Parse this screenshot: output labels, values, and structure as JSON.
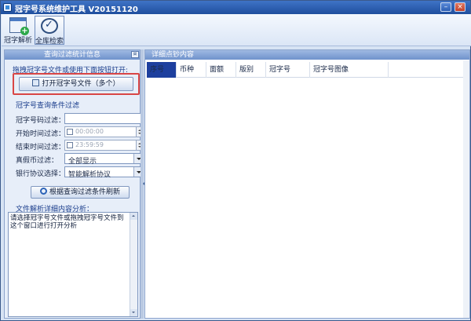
{
  "window": {
    "title": "冠字号系统维护工具 V20151120",
    "min_glyph": "–",
    "close_glyph": "×",
    "app_icon": "app-window-icon"
  },
  "toolbar": {
    "items": [
      {
        "label": "冠字解析",
        "icon": "window-add-icon"
      },
      {
        "label": "全库检索",
        "icon": "check-circle-icon"
      }
    ]
  },
  "left_panel": {
    "header": "查询过滤统计信息",
    "pin_glyph": "¤",
    "drag_hint": "拖拽冠字号文件或使用下面按钮打开:",
    "open_button": "打开冠字号文件（多个）",
    "filter_title": "冠字号查询条件过滤",
    "filters": {
      "code_label": "冠字号码过滤：",
      "code_value": "",
      "start_label": "开始时间过滤：",
      "start_value": "00:00:00",
      "end_label": "结束时间过滤：",
      "end_value": "23:59:59",
      "genuine_label": "真假币过滤：",
      "genuine_value": "全部显示",
      "protocol_label": "银行协议选择：",
      "protocol_value": "智能解析协议"
    },
    "refresh_button": "根据查询过滤条件刷新",
    "analysis_title": "文件解析详细内容分析：",
    "analysis_text": "请选择冠字号文件或拖拽冠字号文件到这个窗口进行打开分析"
  },
  "right_panel": {
    "header": "详细点钞内容",
    "columns": [
      "序号",
      "币种",
      "面额",
      "版别",
      "冠字号",
      "冠字号图像"
    ]
  },
  "colors": {
    "titlebar": "#1f4f9e",
    "panel_header": "#6f92cc",
    "highlight_border": "#d94646",
    "selected_column": "#1d3f9e"
  }
}
